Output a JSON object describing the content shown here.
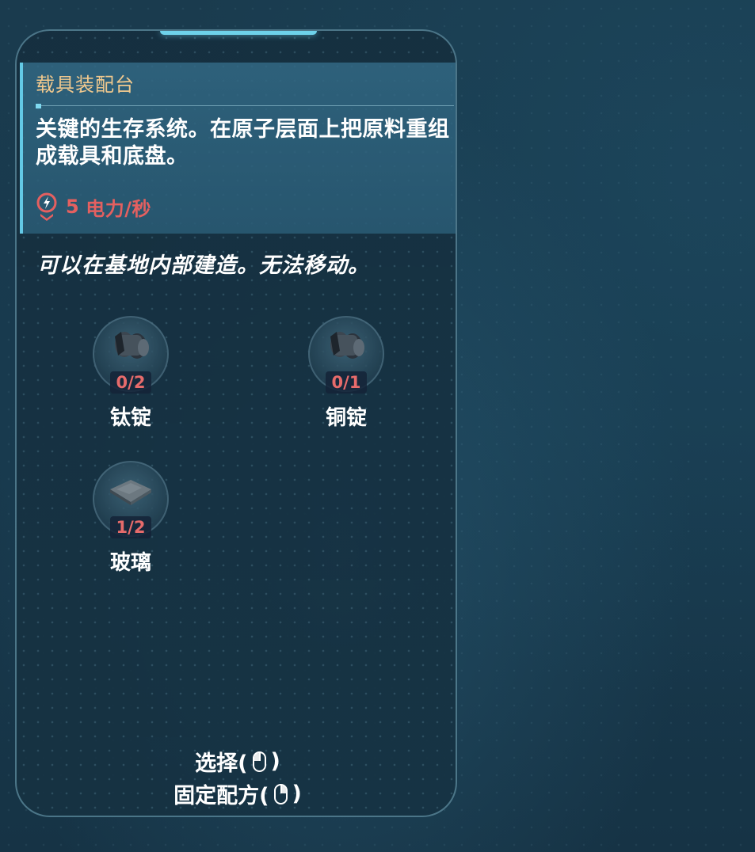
{
  "card": {
    "title": "载具装配台",
    "description": "关键的生存系统。在原子层面上把原料重组成载具和底盘。",
    "power_value": "5",
    "power_unit": "电力/秒",
    "power_icon": "power-icon",
    "note": "可以在基地内部建造。无法移动。"
  },
  "ingredients": [
    {
      "name": "钛锭",
      "count": "0/2",
      "icon": "ingot-icon"
    },
    {
      "name": "铜锭",
      "count": "0/1",
      "icon": "ingot-icon"
    },
    {
      "name": "玻璃",
      "count": "1/2",
      "icon": "glass-icon"
    }
  ],
  "hints": {
    "select_label": "选择(",
    "select_close": ")",
    "pin_label": "固定配方(",
    "pin_close": ")"
  },
  "colors": {
    "title": "#f1c98e",
    "warning": "#e46060",
    "accent": "#63c9e6"
  }
}
